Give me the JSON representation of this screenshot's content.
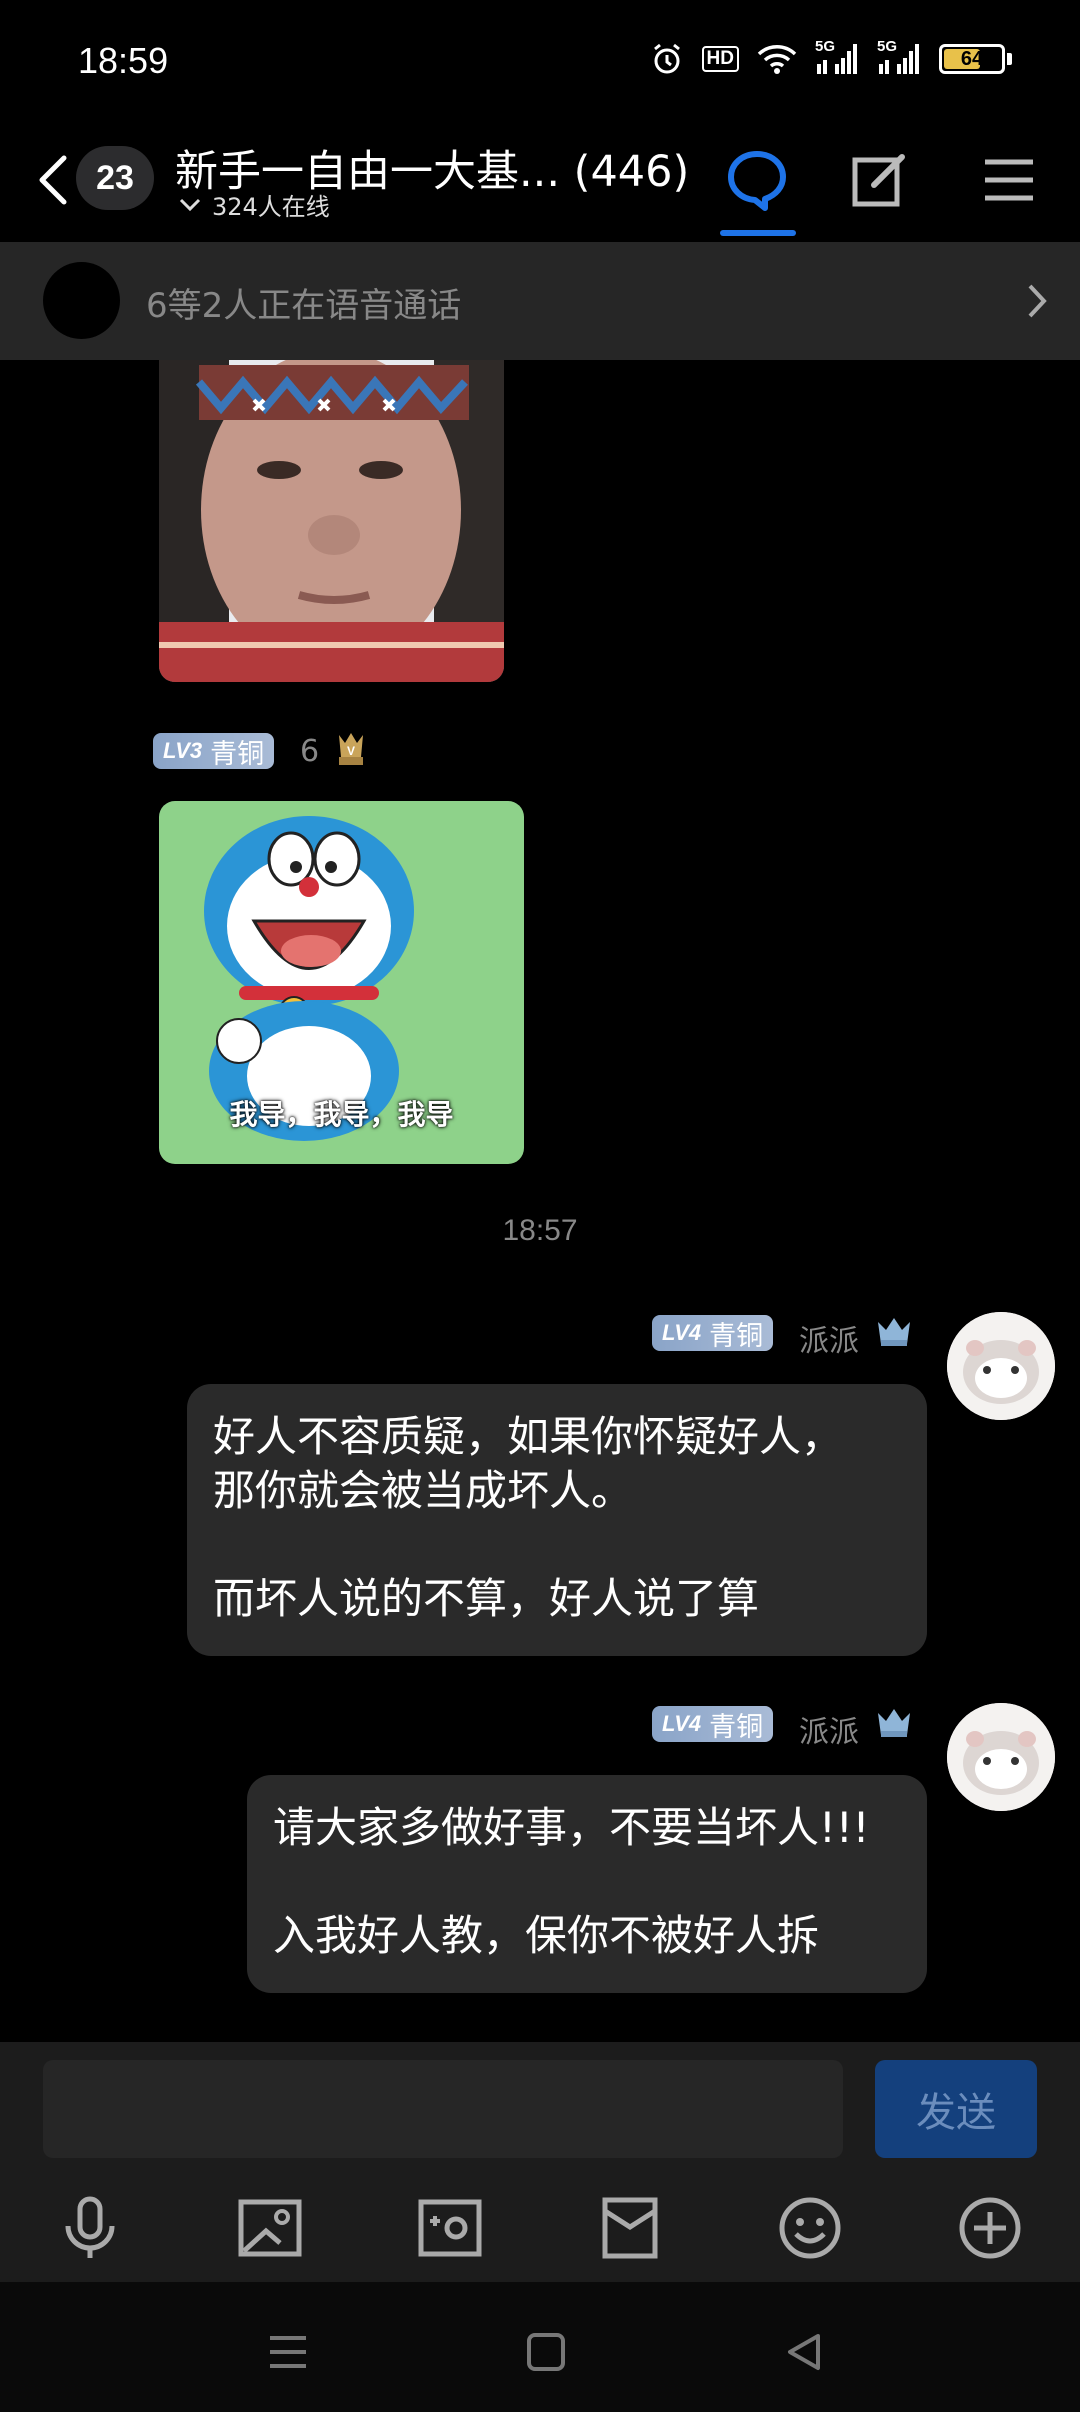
{
  "status_bar": {
    "time": "18:59",
    "battery": "64",
    "battery_level": 0.64,
    "network_1": "5G",
    "network_2": "5G",
    "hd_label": "HD"
  },
  "header": {
    "unread_count": "23",
    "title": "新手一自由一大基... (446)",
    "online": "324人在线"
  },
  "voice_banner": {
    "text": "6等2人正在语音通话"
  },
  "messages": {
    "sticker_caption": "我导，我导，我导",
    "sender1": {
      "level": "LV3",
      "rank": "青铜",
      "name": "6"
    },
    "time_separator": "18:57",
    "sender2": {
      "level": "LV4",
      "rank": "青铜",
      "name": "派派"
    },
    "bubble1": "好人不容质疑，如果你怀疑好人，\n那你就会被当成坏人。\n\n而坏人说的不算，好人说了算",
    "sender3": {
      "level": "LV4",
      "rank": "青铜",
      "name": "派派"
    },
    "bubble2": "请大家多做好事，不要当坏人!!!\n\n入我好人教，保你不被好人拆"
  },
  "input": {
    "send_label": "发送"
  },
  "colors": {
    "accent": "#1e73e8",
    "send_bg": "#14407d",
    "bubble_bg": "#2a2a2a"
  }
}
